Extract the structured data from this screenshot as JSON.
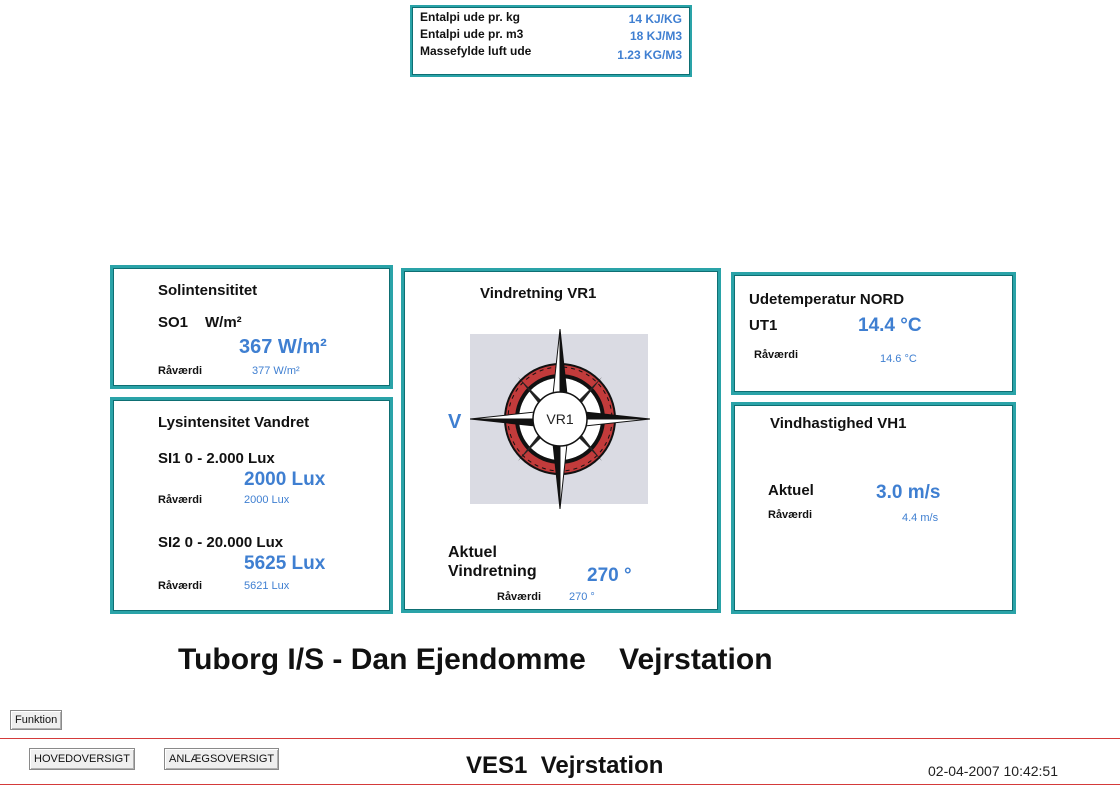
{
  "enthalpy_box": {
    "rows": [
      {
        "label": "Entalpi ude pr. kg",
        "value": "14 KJ/KG"
      },
      {
        "label": "Entalpi ude pr. m3",
        "value": "18 KJ/M3"
      },
      {
        "label": "Massefylde luft ude",
        "value": "1.23 KG/M3"
      }
    ]
  },
  "solar": {
    "title": "Solintensititet",
    "sensor": "SO1",
    "unit": "W/m²",
    "value": "367 W/m²",
    "raw_label": "Råværdi",
    "raw_value": "377 W/m²"
  },
  "light": {
    "title": "Lysintensitet Vandret",
    "s1_label": "SI1  0 -  2.000 Lux",
    "s1_value": "2000 Lux",
    "s1_raw_label": "Råværdi",
    "s1_raw_value": "2000 Lux",
    "s2_label": "SI2  0 - 20.000 Lux",
    "s2_value": "5625 Lux",
    "s2_raw_label": "Råværdi",
    "s2_raw_value": "5621 Lux"
  },
  "wind_direction": {
    "title": "Vindretning  VR1",
    "compass_label": "VR1",
    "direction_letter": "V",
    "actual_label_1": "Aktuel",
    "actual_label_2": "Vindretning",
    "value": "270 °",
    "raw_label": "Råværdi",
    "raw_value": "270 °"
  },
  "temperature": {
    "title": "Udetemperatur NORD",
    "sensor": "UT1",
    "value": "14.4 °C",
    "raw_label": "Råværdi",
    "raw_value": "14.6 °C"
  },
  "wind_speed": {
    "title": "Vindhastighed  VH1",
    "actual_label": "Aktuel",
    "value": "3.0 m/s",
    "raw_label": "Råværdi",
    "raw_value": "4.4 m/s"
  },
  "main_title": "Tuborg I/S - Dan Ejendomme    Vejrstation",
  "toolbar": {
    "funktion_label": "Funktion",
    "hovedoversigt_label": "HOVEDOVERSIGT",
    "anlaegsoversigt_label": "ANLÆGSOVERSIGT"
  },
  "footer": {
    "title": "VES1  Vejrstation",
    "timestamp": "02-04-2007 10:42:51"
  },
  "colors": {
    "panel_border": "#2aa3a8",
    "value_blue": "#3f7fd1",
    "rule_red": "#d43a3a",
    "compass_bg": "#dadbe3",
    "compass_red": "#c23b3b"
  }
}
